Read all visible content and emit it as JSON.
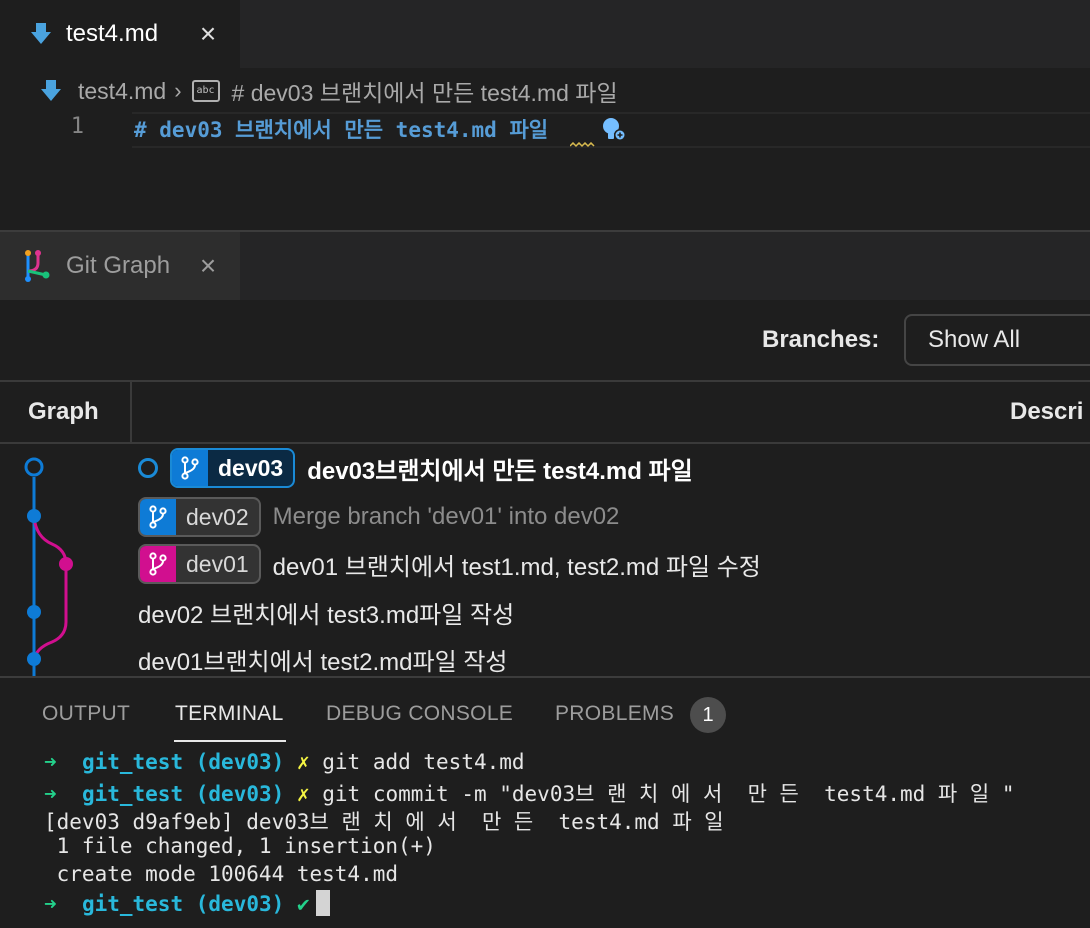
{
  "editor": {
    "tab_label": "test4.md",
    "breadcrumb": {
      "file": "test4.md",
      "symbol_icon_text": "abc",
      "symbol": "# dev03 브랜치에서 만든 test4.md 파일"
    },
    "line_number": "1",
    "code_line": "# dev03 브랜치에서 만든 test4.md 파일"
  },
  "git_graph": {
    "tab_label": "Git Graph",
    "branches_label": "Branches:",
    "branches_select": "Show All",
    "columns": {
      "graph": "Graph",
      "description": "Descri"
    },
    "commits": [
      {
        "branch": "dev03",
        "message": "dev03브랜치에서 만든 test4.md 파일"
      },
      {
        "branch": "dev02",
        "message": "Merge branch 'dev01' into dev02"
      },
      {
        "branch": "dev01",
        "message": "dev01 브랜치에서 test1.md, test2.md 파일 수정"
      },
      {
        "message": "dev02 브랜치에서 test3.md파일 작성"
      },
      {
        "message": "dev01브랜치에서 test2.md파일 작성"
      }
    ],
    "colors": {
      "blue": "#0e7bd6",
      "pink": "#d10f8f"
    }
  },
  "panel": {
    "tabs": [
      "OUTPUT",
      "TERMINAL",
      "DEBUG CONSOLE",
      "PROBLEMS"
    ],
    "active_tab": "TERMINAL",
    "problems_count": "1",
    "terminal": {
      "arrow": "➜",
      "dir": "git_test",
      "branch": "(dev03)",
      "dirty_mark": "✗",
      "clean_mark": "✔",
      "cmd1": "git add test4.md",
      "cmd2": "git commit -m \"dev03브 랜 치 에 서  만 든  test4.md 파 일 \"",
      "out1": "[dev03 d9af9eb] dev03브 랜 치 에 서  만 든  test4.md 파 일",
      "out2": " 1 file changed, 1 insertion(+)",
      "out3": " create mode 100644 test4.md"
    }
  }
}
